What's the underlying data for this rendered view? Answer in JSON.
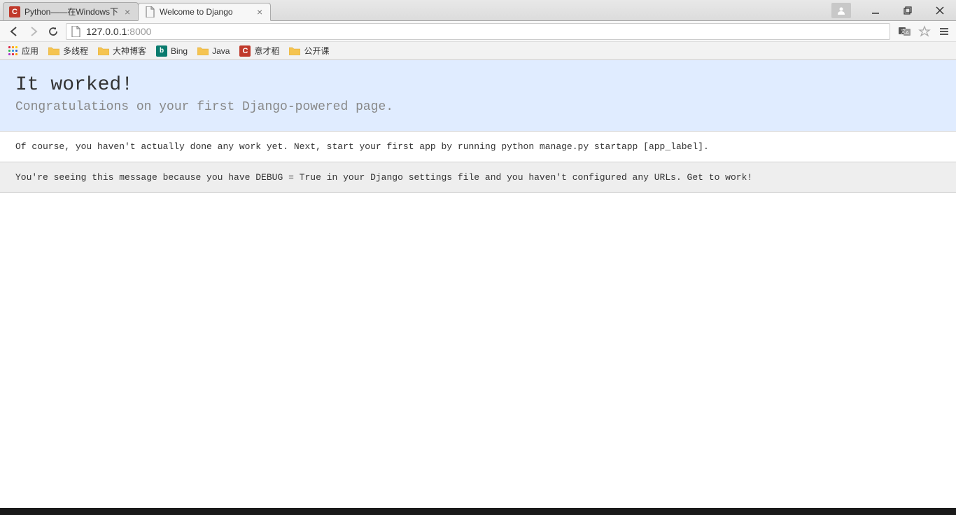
{
  "tabs": [
    {
      "title": "Python——在Windows下",
      "active": false,
      "favicon": "c-red"
    },
    {
      "title": "Welcome to Django",
      "active": true,
      "favicon": "page"
    }
  ],
  "address": {
    "host": "127.0.0.1",
    "port": ":8000"
  },
  "apps_label": "应用",
  "bookmarks": [
    {
      "label": "多线程",
      "icon": "folder"
    },
    {
      "label": "大神博客",
      "icon": "folder"
    },
    {
      "label": "Bing",
      "icon": "bing"
    },
    {
      "label": "Java",
      "icon": "folder"
    },
    {
      "label": "意才稻",
      "icon": "c-red"
    },
    {
      "label": "公开课",
      "icon": "folder"
    }
  ],
  "page": {
    "heading": "It worked!",
    "subheading": "Congratulations on your first Django-powered page.",
    "instructions": "Of course, you haven't actually done any work yet. Next, start your first app by running python manage.py startapp [app_label].",
    "explanation": "You're seeing this message because you have DEBUG = True in your Django settings file and you haven't configured any URLs. Get to work!"
  }
}
